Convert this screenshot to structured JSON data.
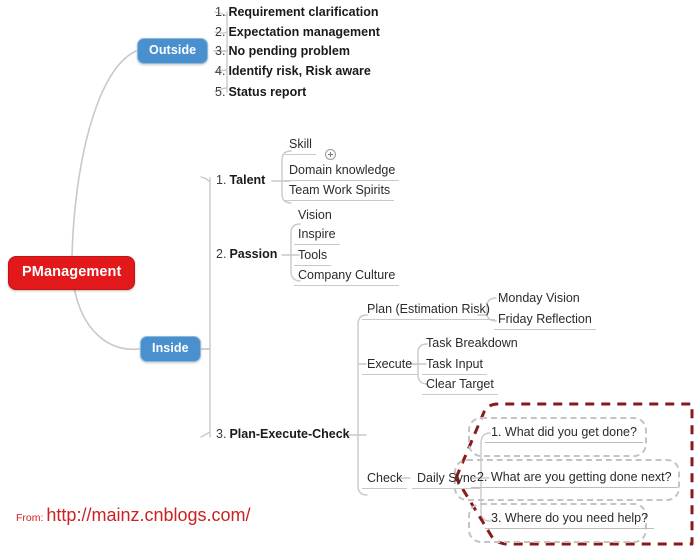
{
  "map": {
    "root": {
      "label": "PManagement"
    },
    "branches": [
      {
        "id": "outside",
        "label": "Outside",
        "topics": [
          {
            "num": "1.",
            "text": "Requirement clarification"
          },
          {
            "num": "2.",
            "text": "Expectation management"
          },
          {
            "num": "3.",
            "text": "No pending problem"
          },
          {
            "num": "4.",
            "text": "Identify risk, Risk aware"
          },
          {
            "num": "5.",
            "text": "Status report"
          }
        ]
      },
      {
        "id": "inside",
        "label": "Inside",
        "topics": [
          {
            "num": "1.",
            "text": "Talent"
          },
          {
            "num": "2.",
            "text": "Passion"
          },
          {
            "num": "3.",
            "text": "Plan-Execute-Check"
          }
        ]
      }
    ],
    "talent_children": [
      {
        "label": "Skill",
        "collapsed": true
      },
      {
        "label": "Domain knowledge"
      },
      {
        "label": "Team Work Spirits"
      }
    ],
    "passion_children": [
      {
        "label": "Vision"
      },
      {
        "label": "Inspire"
      },
      {
        "label": "Tools"
      },
      {
        "label": "Company Culture"
      }
    ],
    "pec": {
      "plan": {
        "label": "Plan (Estimation Risk)",
        "children": [
          {
            "label": "Monday Vision"
          },
          {
            "label": "Friday Reflection"
          }
        ]
      },
      "execute": {
        "label": "Execute",
        "children": [
          {
            "label": "Task Breakdown"
          },
          {
            "label": "Task Input"
          },
          {
            "label": "Clear Target"
          }
        ]
      },
      "check": {
        "label": "Check",
        "daily_sync": {
          "label": "Daily Sync",
          "questions": [
            {
              "num": "1.",
              "text": "What did you get done?"
            },
            {
              "num": "2.",
              "text": "What are you getting done next?"
            },
            {
              "num": "3.",
              "text": "Where do you need help?"
            }
          ]
        }
      }
    }
  },
  "credit": {
    "from_label": "From:",
    "url": "http://mainz.cnblogs.com/"
  },
  "colors": {
    "root_fill": "#e2181b",
    "branch_fill": "#4a90cf",
    "callout_stroke": "#8b1a1a",
    "qbox_stroke": "#c4c4c4",
    "wire": "#c9c9c9",
    "credit": "#cc2222"
  }
}
